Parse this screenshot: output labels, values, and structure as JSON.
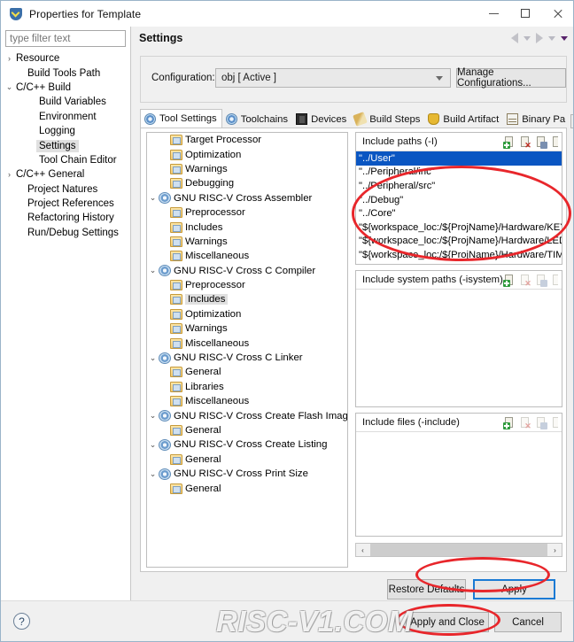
{
  "window": {
    "title": "Properties for Template",
    "icon": "shield-icon",
    "minimize_label": "",
    "maximize_label": "",
    "close_label": ""
  },
  "left_pane": {
    "filter_placeholder": "type filter text",
    "tree": [
      {
        "label": "Resource",
        "indent": 0,
        "arrow": "›",
        "selected": false
      },
      {
        "label": "Build Tools Path",
        "indent": 1,
        "arrow": "",
        "selected": false
      },
      {
        "label": "C/C++ Build",
        "indent": 0,
        "arrow": "⌄",
        "selected": false
      },
      {
        "label": "Build Variables",
        "indent": 2,
        "arrow": "",
        "selected": false
      },
      {
        "label": "Environment",
        "indent": 2,
        "arrow": "",
        "selected": false
      },
      {
        "label": "Logging",
        "indent": 2,
        "arrow": "",
        "selected": false
      },
      {
        "label": "Settings",
        "indent": 2,
        "arrow": "",
        "selected": true
      },
      {
        "label": "Tool Chain Editor",
        "indent": 2,
        "arrow": "",
        "selected": false
      },
      {
        "label": "C/C++ General",
        "indent": 0,
        "arrow": "›",
        "selected": false
      },
      {
        "label": "Project Natures",
        "indent": 1,
        "arrow": "",
        "selected": false
      },
      {
        "label": "Project References",
        "indent": 1,
        "arrow": "",
        "selected": false
      },
      {
        "label": "Refactoring History",
        "indent": 1,
        "arrow": "",
        "selected": false
      },
      {
        "label": "Run/Debug Settings",
        "indent": 1,
        "arrow": "",
        "selected": false
      }
    ]
  },
  "settings": {
    "page_title": "Settings",
    "nav_back": "back-arrow",
    "nav_forward": "forward-arrow",
    "configuration_label": "Configuration:",
    "configuration_value": "obj  [ Active ]",
    "manage_configurations_label": "Manage Configurations..."
  },
  "tabs": [
    {
      "label": "Tool Settings",
      "icon": "gear-icon",
      "active": true
    },
    {
      "label": "Toolchains",
      "icon": "gear-icon",
      "active": false
    },
    {
      "label": "Devices",
      "icon": "chip-icon",
      "active": false
    },
    {
      "label": "Build Steps",
      "icon": "wrench-icon",
      "active": false
    },
    {
      "label": "Build Artifact",
      "icon": "trophy-icon",
      "active": false
    },
    {
      "label": "Binary Pa",
      "icon": "table-icon",
      "active": false
    }
  ],
  "tab_scroll": {
    "left": "◄",
    "right": "►"
  },
  "tool_tree": [
    {
      "label": "Target Processor",
      "indent": 1,
      "expander": "",
      "icon": "folder-icon",
      "selected": false
    },
    {
      "label": "Optimization",
      "indent": 1,
      "expander": "",
      "icon": "folder-icon",
      "selected": false
    },
    {
      "label": "Warnings",
      "indent": 1,
      "expander": "",
      "icon": "folder-icon",
      "selected": false
    },
    {
      "label": "Debugging",
      "indent": 1,
      "expander": "",
      "icon": "folder-icon",
      "selected": false
    },
    {
      "label": "GNU RISC-V Cross Assembler",
      "indent": 0,
      "expander": "⌄",
      "icon": "tool-icon",
      "selected": false
    },
    {
      "label": "Preprocessor",
      "indent": 1,
      "expander": "",
      "icon": "folder-icon",
      "selected": false
    },
    {
      "label": "Includes",
      "indent": 1,
      "expander": "",
      "icon": "folder-icon",
      "selected": false
    },
    {
      "label": "Warnings",
      "indent": 1,
      "expander": "",
      "icon": "folder-icon",
      "selected": false
    },
    {
      "label": "Miscellaneous",
      "indent": 1,
      "expander": "",
      "icon": "folder-icon",
      "selected": false
    },
    {
      "label": "GNU RISC-V Cross C Compiler",
      "indent": 0,
      "expander": "⌄",
      "icon": "tool-icon",
      "selected": false
    },
    {
      "label": "Preprocessor",
      "indent": 1,
      "expander": "",
      "icon": "folder-icon",
      "selected": false
    },
    {
      "label": "Includes",
      "indent": 1,
      "expander": "",
      "icon": "folder-icon",
      "selected": true
    },
    {
      "label": "Optimization",
      "indent": 1,
      "expander": "",
      "icon": "folder-icon",
      "selected": false
    },
    {
      "label": "Warnings",
      "indent": 1,
      "expander": "",
      "icon": "folder-icon",
      "selected": false
    },
    {
      "label": "Miscellaneous",
      "indent": 1,
      "expander": "",
      "icon": "folder-icon",
      "selected": false
    },
    {
      "label": "GNU RISC-V Cross C Linker",
      "indent": 0,
      "expander": "⌄",
      "icon": "tool-icon",
      "selected": false
    },
    {
      "label": "General",
      "indent": 1,
      "expander": "",
      "icon": "folder-icon",
      "selected": false
    },
    {
      "label": "Libraries",
      "indent": 1,
      "expander": "",
      "icon": "folder-icon",
      "selected": false
    },
    {
      "label": "Miscellaneous",
      "indent": 1,
      "expander": "",
      "icon": "folder-icon",
      "selected": false
    },
    {
      "label": "GNU RISC-V Cross Create Flash Image",
      "indent": 0,
      "expander": "⌄",
      "icon": "tool-icon",
      "selected": false
    },
    {
      "label": "General",
      "indent": 1,
      "expander": "",
      "icon": "folder-icon",
      "selected": false
    },
    {
      "label": "GNU RISC-V Cross Create Listing",
      "indent": 0,
      "expander": "⌄",
      "icon": "tool-icon",
      "selected": false
    },
    {
      "label": "General",
      "indent": 1,
      "expander": "",
      "icon": "folder-icon",
      "selected": false
    },
    {
      "label": "GNU RISC-V Cross Print Size",
      "indent": 0,
      "expander": "⌄",
      "icon": "tool-icon",
      "selected": false
    },
    {
      "label": "General",
      "indent": 1,
      "expander": "",
      "icon": "folder-icon",
      "selected": false
    }
  ],
  "sections": {
    "include_paths": {
      "title": "Include paths (-I)",
      "entries": [
        {
          "value": "\"../User\"",
          "selected": true
        },
        {
          "value": "\"../Peripheral/inc\"",
          "selected": false
        },
        {
          "value": "\"../Peripheral/src\"",
          "selected": false
        },
        {
          "value": "\"../Debug\"",
          "selected": false
        },
        {
          "value": "\"../Core\"",
          "selected": false
        },
        {
          "value": "\"${workspace_loc:/${ProjName}/Hardware/KEY}\"",
          "selected": false
        },
        {
          "value": "\"${workspace_loc:/${ProjName}/Hardware/LED}\"",
          "selected": false
        },
        {
          "value": "\"${workspace_loc:/${ProjName}/Hardware/TIMER}\"",
          "selected": false
        }
      ]
    },
    "include_system_paths": {
      "title": "Include system paths (-isystem)",
      "entries": []
    },
    "include_files": {
      "title": "Include files (-include)",
      "entries": []
    }
  },
  "section_toolbar_icons": [
    "add-icon",
    "delete-icon",
    "edit-icon",
    "move-up-icon"
  ],
  "scrollbar": {
    "left_arrow": "‹",
    "right_arrow": "›"
  },
  "buttons": {
    "restore_defaults": "Restore Defaults",
    "apply": "Apply",
    "apply_and_close": "Apply and Close",
    "cancel": "Cancel",
    "help": "?"
  },
  "watermark": {
    "text": "RISC-V1.COM"
  },
  "colors": {
    "selection_blue": "#0a56c2",
    "annotation_red": "#e8262b",
    "apply_focus_border": "#1a7ad4"
  }
}
